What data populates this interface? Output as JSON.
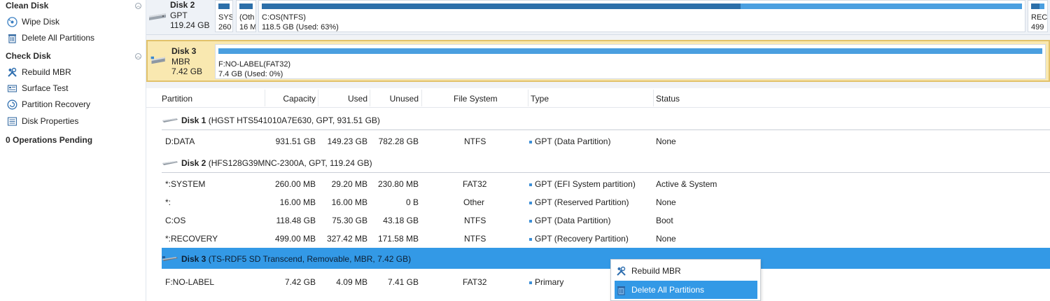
{
  "sidebar": {
    "clean_disk": {
      "header": "Clean Disk",
      "items": [
        {
          "label": "Wipe Disk",
          "icon": "wipe-disk-icon"
        },
        {
          "label": "Delete All Partitions",
          "icon": "delete-partitions-icon"
        }
      ]
    },
    "check_disk": {
      "header": "Check Disk",
      "items": [
        {
          "label": "Rebuild MBR",
          "icon": "rebuild-mbr-icon"
        },
        {
          "label": "Surface Test",
          "icon": "surface-test-icon"
        },
        {
          "label": "Partition Recovery",
          "icon": "partition-recovery-icon"
        },
        {
          "label": "Disk Properties",
          "icon": "disk-properties-icon"
        }
      ]
    },
    "pending": "0 Operations Pending"
  },
  "diskmap": {
    "disk2": {
      "name": "Disk 2",
      "style": "GPT",
      "size": "119.24 GB",
      "partitions": [
        {
          "line1": "SYS",
          "line2": "260",
          "used_fraction": 1.0
        },
        {
          "line1": "(Oth",
          "line2": "16 M",
          "used_fraction": 1.0
        },
        {
          "line1": "C:OS(NTFS)",
          "line2": "118.5 GB (Used: 63%)",
          "used_fraction": 0.63
        },
        {
          "line1": "REC",
          "line2": "499",
          "used_fraction": 0.65
        }
      ]
    },
    "disk3": {
      "name": "Disk 3",
      "style": "MBR",
      "size": "7.42 GB",
      "partitions": [
        {
          "line1": "F:NO-LABEL(FAT32)",
          "line2": "7.4 GB (Used: 0%)",
          "used_fraction": 0.0
        }
      ]
    }
  },
  "table": {
    "headers": [
      "Partition",
      "Capacity",
      "Used",
      "Unused",
      "File System",
      "Type",
      "Status"
    ],
    "groups": [
      {
        "disk": "Disk 1",
        "desc": " (HGST HTS541010A7E630, GPT, 931.51 GB)",
        "rows": [
          {
            "partition": "D:DATA",
            "capacity": "931.51 GB",
            "used": "149.23 GB",
            "unused": "782.28 GB",
            "fs": "NTFS",
            "type": "GPT (Data Partition)",
            "status": "None"
          }
        ]
      },
      {
        "disk": "Disk 2",
        "desc": " (HFS128G39MNC-2300A, GPT, 119.24 GB)",
        "rows": [
          {
            "partition": "*:SYSTEM",
            "capacity": "260.00 MB",
            "used": "29.20 MB",
            "unused": "230.80 MB",
            "fs": "FAT32",
            "type": "GPT (EFI System partition)",
            "status": "Active & System"
          },
          {
            "partition": "*:",
            "capacity": "16.00 MB",
            "used": "16.00 MB",
            "unused": "0 B",
            "fs": "Other",
            "type": "GPT (Reserved Partition)",
            "status": "None"
          },
          {
            "partition": "C:OS",
            "capacity": "118.48 GB",
            "used": "75.30 GB",
            "unused": "43.18 GB",
            "fs": "NTFS",
            "type": "GPT (Data Partition)",
            "status": "Boot"
          },
          {
            "partition": "*:RECOVERY",
            "capacity": "499.00 MB",
            "used": "327.42 MB",
            "unused": "171.58 MB",
            "fs": "NTFS",
            "type": "GPT (Recovery Partition)",
            "status": "None"
          }
        ]
      },
      {
        "disk": "Disk 3",
        "desc": " (TS-RDF5 SD Transcend, Removable, MBR, 7.42 GB)",
        "rows": [
          {
            "partition": "F:NO-LABEL",
            "capacity": "7.42 GB",
            "used": "4.09 MB",
            "unused": "7.41 GB",
            "fs": "FAT32",
            "type": "Primary",
            "status": ""
          }
        ]
      }
    ]
  },
  "context_menu": {
    "items": [
      {
        "label": "Rebuild MBR",
        "icon": "rebuild-mbr-icon"
      },
      {
        "label": "Delete All Partitions",
        "icon": "delete-partitions-icon",
        "highlighted": true
      }
    ]
  },
  "colors": {
    "selection": "#3399e6",
    "bar": "#4a9fe0",
    "bar_used": "#2c6fa9",
    "selected_disk": "#f9e8b0"
  }
}
